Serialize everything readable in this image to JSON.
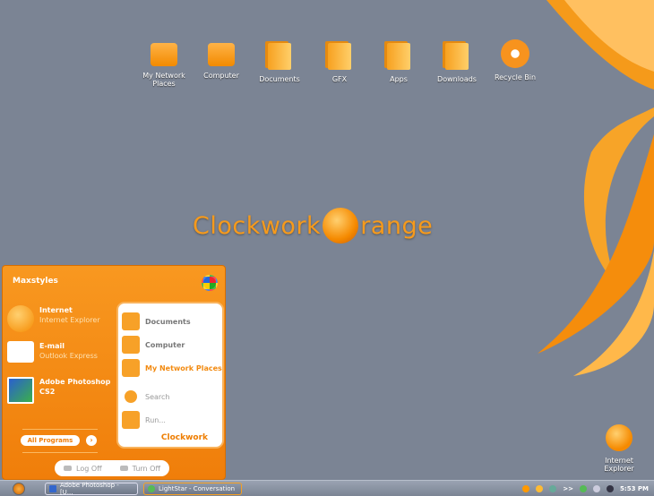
{
  "desktop": {
    "icons": [
      {
        "label": "My Network Places",
        "icon": "network-icon"
      },
      {
        "label": "Computer",
        "icon": "computer-icon"
      },
      {
        "label": "Documents",
        "icon": "documents-icon"
      },
      {
        "label": "GFX",
        "icon": "folder-icon"
      },
      {
        "label": "Apps",
        "icon": "folder-icon"
      },
      {
        "label": "Downloads",
        "icon": "folder-icon"
      },
      {
        "label": "Recycle Bin",
        "icon": "recycle-bin-icon"
      }
    ],
    "ie_icon": {
      "label": "Internet Explorer"
    },
    "logo": {
      "left": "Clockwork",
      "right": "range"
    }
  },
  "start_menu": {
    "user": "Maxstyles",
    "pinned": [
      {
        "title": "Internet",
        "sub": "Internet Explorer"
      },
      {
        "title": "E-mail",
        "sub": "Outlook Express"
      },
      {
        "title": "Adobe Photoshop",
        "sub": "CS2"
      }
    ],
    "all_programs": "All Programs",
    "right": [
      "Documents",
      "Computer",
      "My Network Places",
      "Search",
      "Run..."
    ],
    "brand": "Clockwork",
    "log_off": "Log Off",
    "turn_off": "Turn Off"
  },
  "taskbar": {
    "tasks": [
      "Adobe Photoshop - [U...",
      "LightStar - Conversation"
    ],
    "overflow": ">>",
    "clock": "5:53 PM"
  }
}
